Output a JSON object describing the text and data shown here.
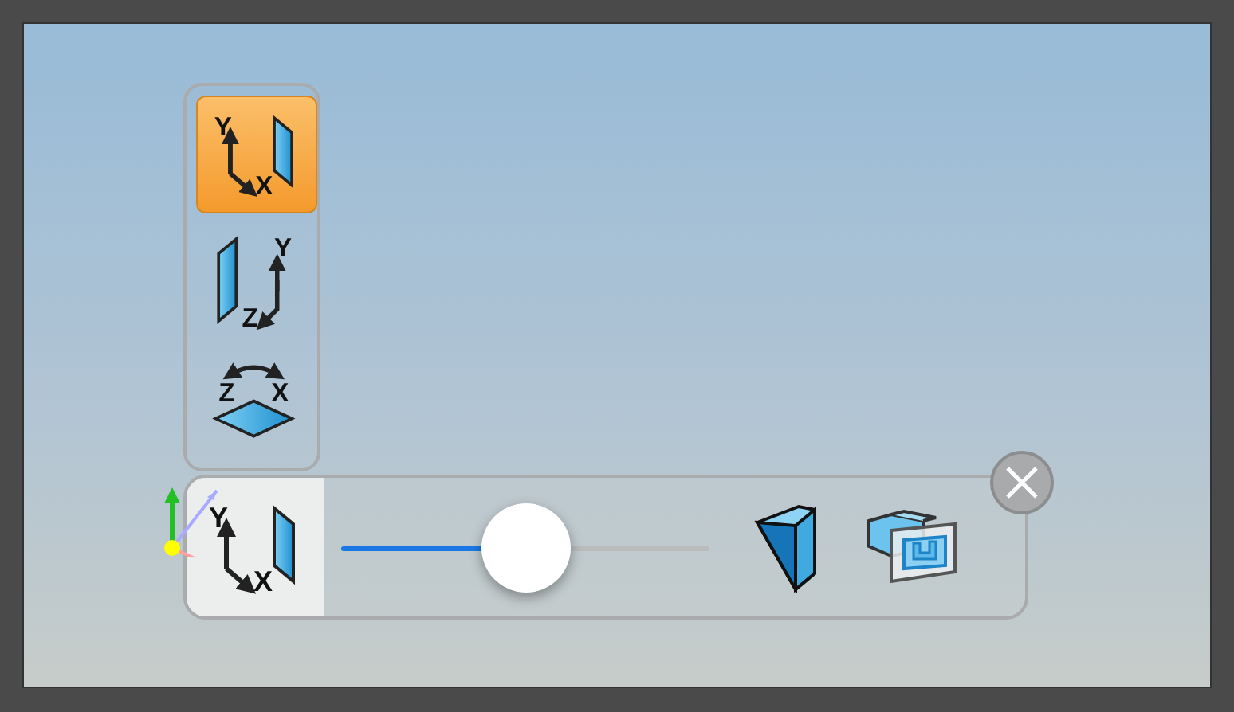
{
  "planes": [
    {
      "kind": "xy",
      "selected": true,
      "labels": [
        "Y",
        "X"
      ]
    },
    {
      "kind": "zy",
      "selected": false,
      "labels": [
        "Y",
        "Z"
      ]
    },
    {
      "kind": "zx",
      "selected": false,
      "labels": [
        "Z",
        "X"
      ]
    }
  ],
  "toolbar": {
    "current": {
      "kind": "xy",
      "labels": [
        "Y",
        "X"
      ]
    },
    "slider": {
      "level": 0.5
    }
  }
}
